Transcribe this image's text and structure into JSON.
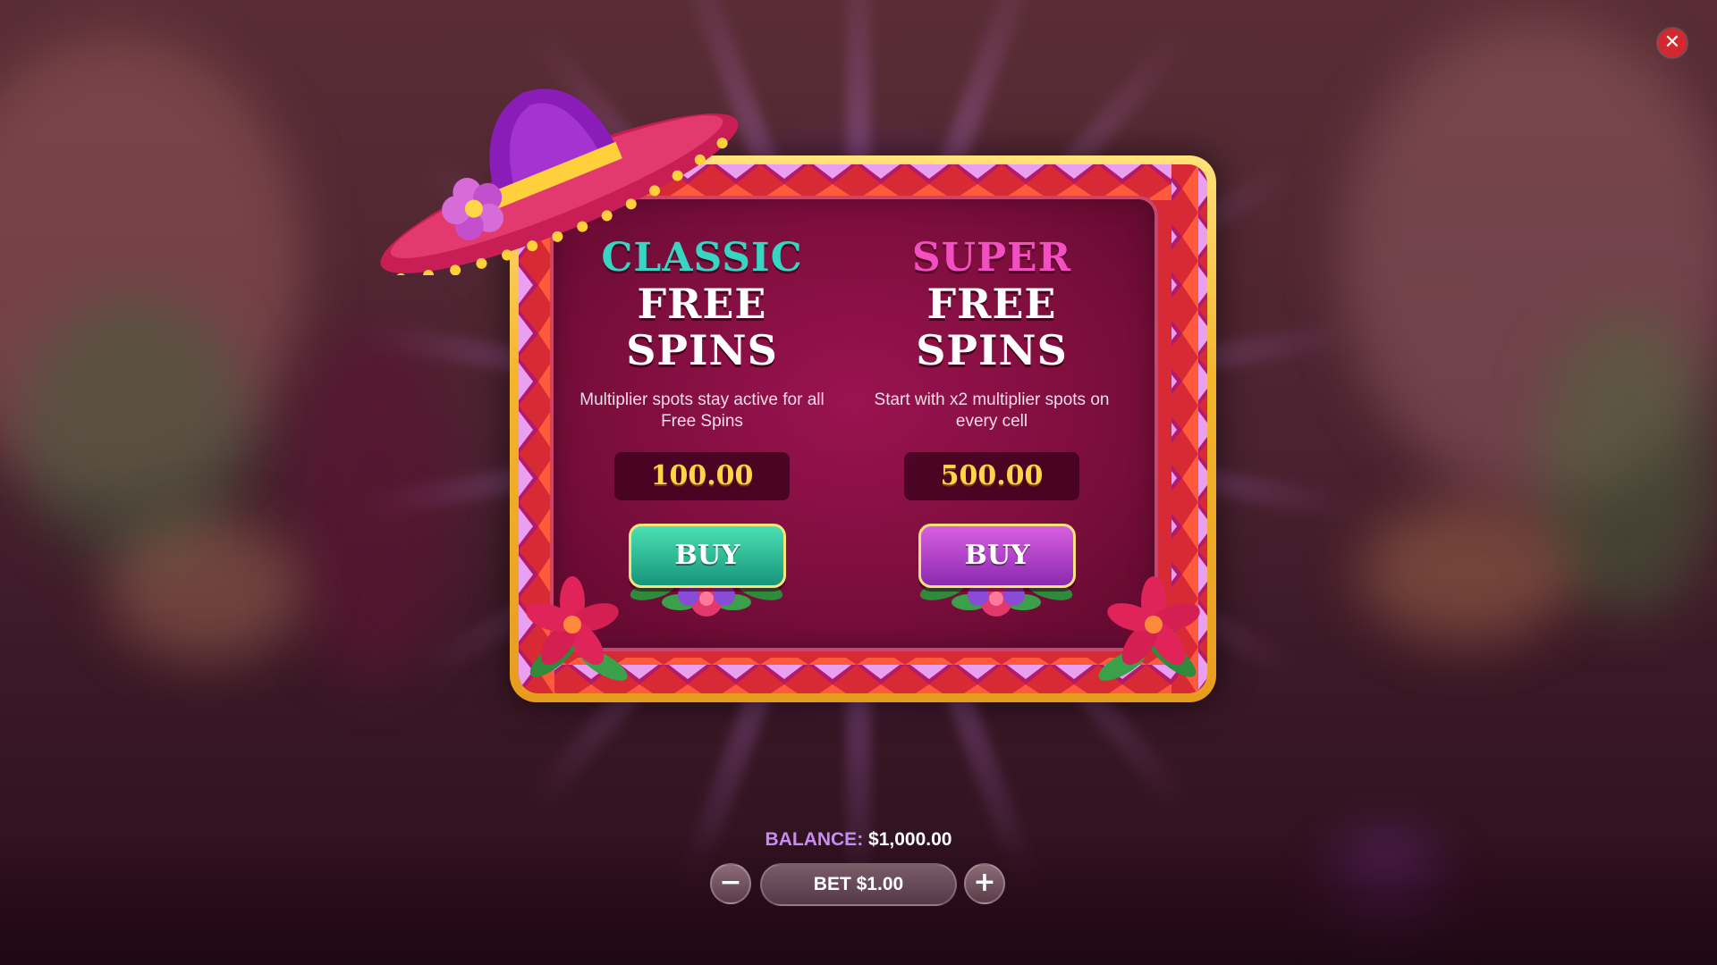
{
  "close": {
    "icon": "close-icon",
    "glyph": "✕",
    "color": "#d3282d"
  },
  "offers": {
    "classic": {
      "kind": "CLASSIC",
      "title": "FREE SPINS",
      "description": "Multiplier spots stay active for all Free Spins",
      "price": "100.00",
      "buy_label": "BUY",
      "accent": "#38d5c3"
    },
    "super": {
      "kind": "SUPER",
      "title": "FREE SPINS",
      "description": "Start with x2 multiplier spots on every cell",
      "price": "500.00",
      "buy_label": "BUY",
      "accent": "#f24fc1"
    }
  },
  "footer": {
    "balance_label": "BALANCE:",
    "balance_value": "$1,000.00",
    "bet_label": "BET $1.00",
    "minus": "−",
    "plus": "+"
  },
  "decor": {
    "sombrero": "sombrero-icon",
    "flowers": "flower-icon"
  }
}
